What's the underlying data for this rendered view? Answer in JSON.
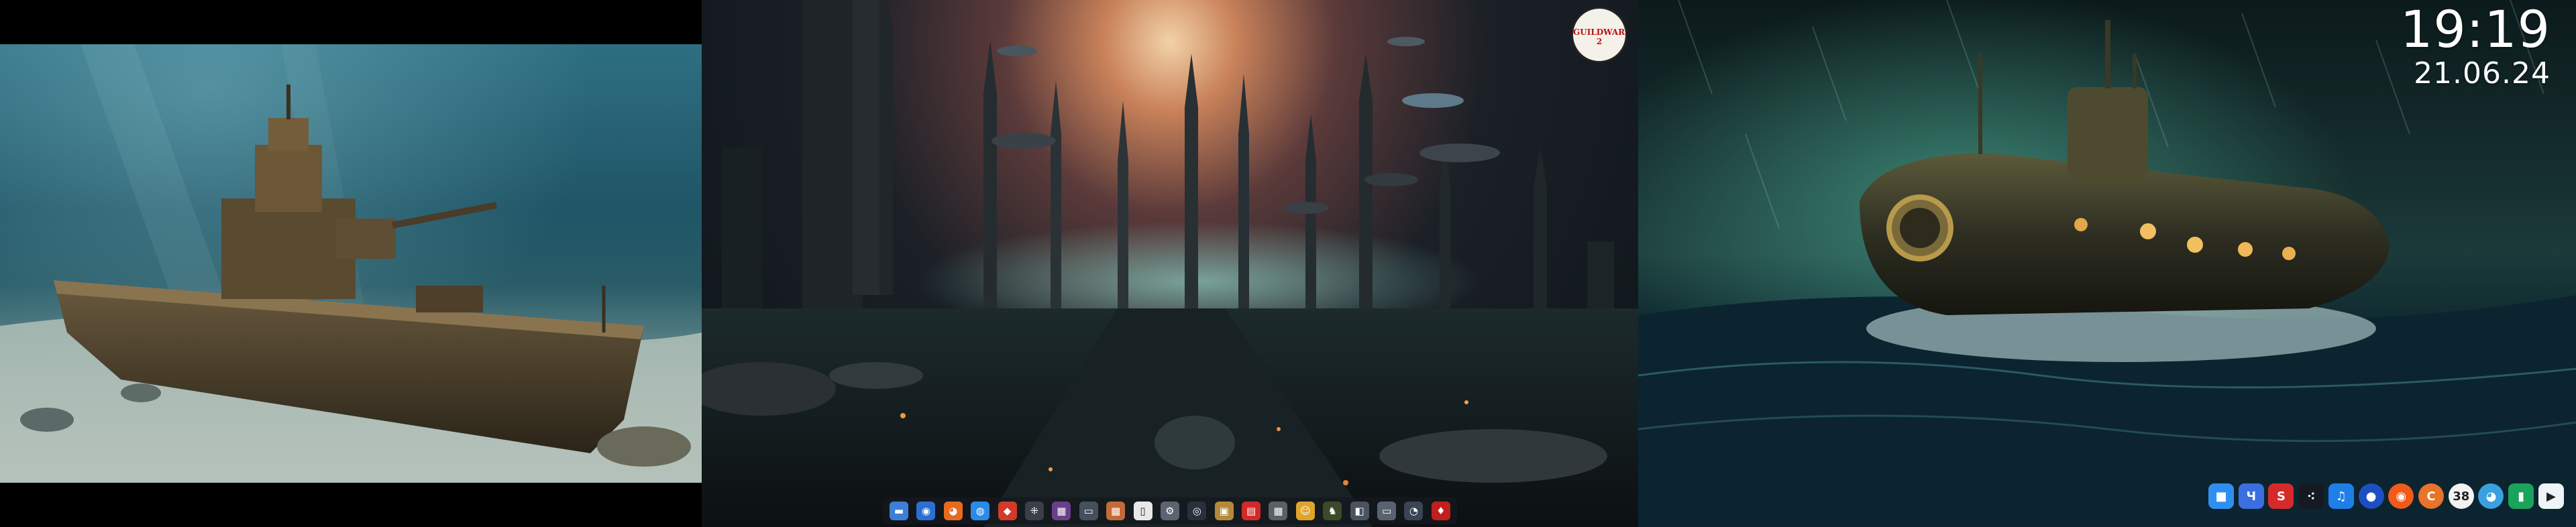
{
  "clock": {
    "time": "19:19",
    "date": "21.06.24"
  },
  "badge_logo": {
    "icon": "gw2-dragon-logo",
    "text": "GUILDWARS 2"
  },
  "dock_middle": {
    "apps": [
      {
        "name": "file-manager-icon",
        "glyph": "▬",
        "color": "#3d7fd6"
      },
      {
        "name": "chromium-icon",
        "glyph": "◉",
        "color": "#2b6fd1"
      },
      {
        "name": "firefox-icon",
        "glyph": "◕",
        "color": "#e86a1f"
      },
      {
        "name": "globe-browser-icon",
        "glyph": "◍",
        "color": "#2a8be6"
      },
      {
        "name": "red-app-icon",
        "glyph": "◆",
        "color": "#d23a2a"
      },
      {
        "name": "network-tool-icon",
        "glyph": "⁜",
        "color": "#3a3f48"
      },
      {
        "name": "image-viewer-icon",
        "glyph": "▦",
        "color": "#6a3f8a"
      },
      {
        "name": "screen-capture-icon",
        "glyph": "▭",
        "color": "#44505c"
      },
      {
        "name": "texture-app-icon",
        "glyph": "▩",
        "color": "#c26a3a"
      },
      {
        "name": "document-icon",
        "glyph": "▯",
        "color": "#e8e8e8"
      },
      {
        "name": "settings-gear-icon",
        "glyph": "⚙",
        "color": "#5b6470"
      },
      {
        "name": "steam-like-icon",
        "glyph": "◎",
        "color": "#27303c"
      },
      {
        "name": "archive-icon",
        "glyph": "▣",
        "color": "#b48a3a"
      },
      {
        "name": "pdf-icon",
        "glyph": "▤",
        "color": "#d02a2a"
      },
      {
        "name": "calculator-icon",
        "glyph": "▦",
        "color": "#5a5f68"
      },
      {
        "name": "emoji-app-icon",
        "glyph": "☺",
        "color": "#e0a42a"
      },
      {
        "name": "game-icon",
        "glyph": "♞",
        "color": "#3c4a2a"
      },
      {
        "name": "launcher-icon",
        "glyph": "◧",
        "color": "#4a5460"
      },
      {
        "name": "monitor-icon",
        "glyph": "▭",
        "color": "#5a6270"
      },
      {
        "name": "system-icon",
        "glyph": "◔",
        "color": "#3a4454"
      },
      {
        "name": "guildwars-icon",
        "glyph": "♦",
        "color": "#c21f1f"
      }
    ]
  },
  "dock_right": {
    "apps": [
      {
        "name": "finder-square-icon",
        "glyph": "■",
        "color": "#2f8ff0",
        "round": false
      },
      {
        "name": "u-app-icon",
        "glyph": "Ч",
        "color": "#3b6fe0",
        "round": false
      },
      {
        "name": "s-app-icon",
        "glyph": "S",
        "color": "#d62a2a",
        "round": false
      },
      {
        "name": "dots-app-icon",
        "glyph": "⁖",
        "color": "#151a22",
        "round": false
      },
      {
        "name": "music-icon",
        "glyph": "♫",
        "color": "#1e7fe8",
        "round": false
      },
      {
        "name": "radio-app-icon",
        "glyph": "●",
        "color": "#1d4fc2",
        "round": true
      },
      {
        "name": "orange-app-icon",
        "glyph": "◉",
        "color": "#f05a1a",
        "round": true
      },
      {
        "name": "c-app-icon",
        "glyph": "C",
        "color": "#e8732a",
        "round": true
      },
      {
        "name": "badge-38-icon",
        "glyph": "38",
        "color": "#f2f2f2",
        "round": true
      },
      {
        "name": "multicolor-app-icon",
        "glyph": "◕",
        "color": "#3aa0e0",
        "round": true
      },
      {
        "name": "slides-app-icon",
        "glyph": "▮",
        "color": "#1aa35a",
        "round": false
      },
      {
        "name": "play-store-icon",
        "glyph": "▶",
        "color": "#eef4f8",
        "round": false
      }
    ]
  }
}
